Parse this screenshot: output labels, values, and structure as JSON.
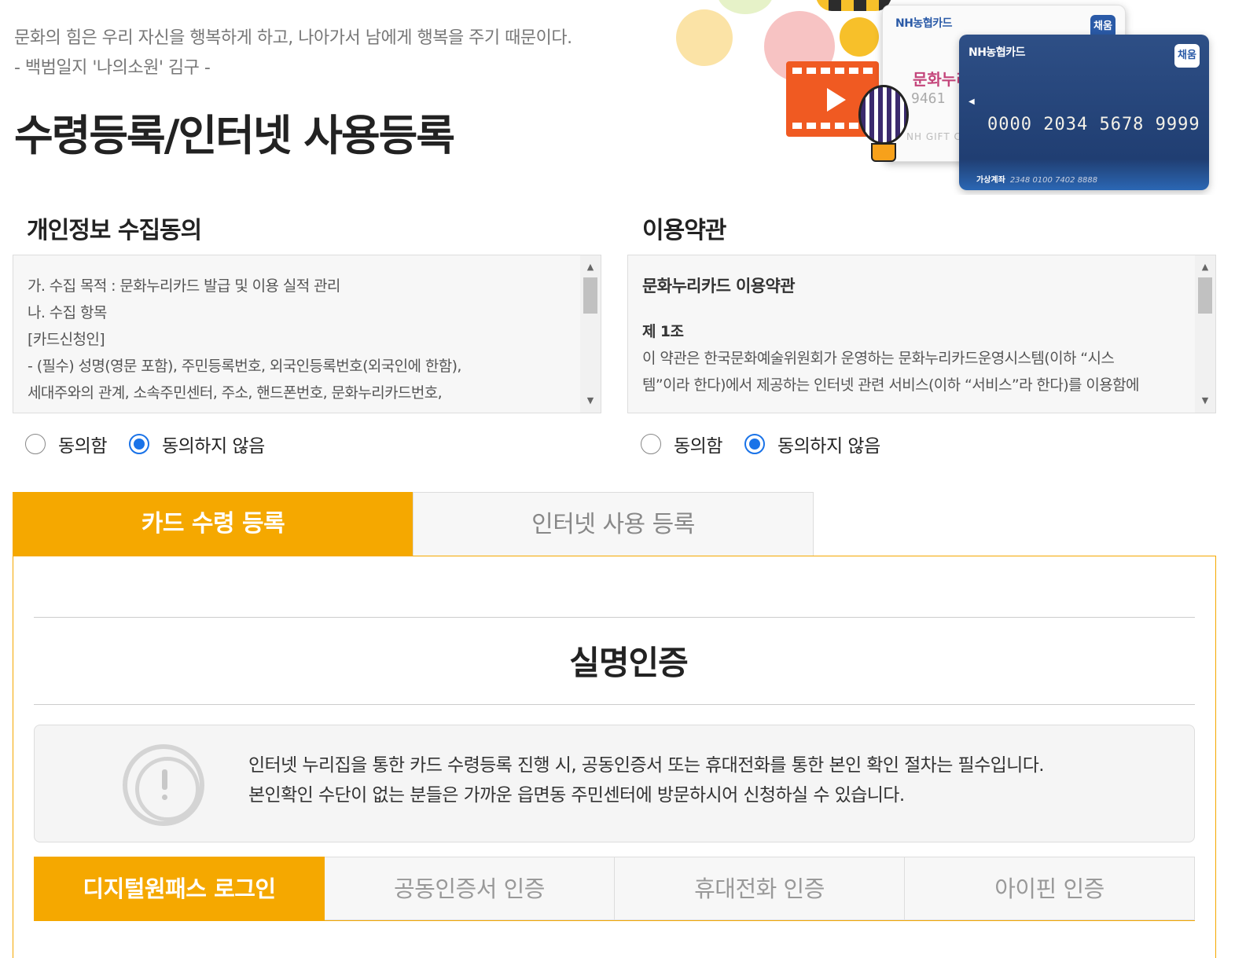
{
  "header": {
    "quote_line1": "문화의 힘은 우리 자신을 행복하게 하고, 나아가서 남에게 행복을 주기 때문이다.",
    "quote_line2": "- 백범일지 '나의소원' 김구 -",
    "title": "수령등록/인터넷 사용등록"
  },
  "hero": {
    "card_white": {
      "brand": "NH농협카드",
      "chip": "채움",
      "product": "문화누리",
      "number": "9461",
      "footer": "NH GIFT CA"
    },
    "card_blue": {
      "brand": "NH농협카드",
      "chip": "채움",
      "number": "0000 2034 5678 9999",
      "account_label": "가상계좌",
      "account_number": "2348 0100 7402 8888"
    },
    "colors": {
      "brand_blue": "#2a5aa7",
      "card_blue": "#203e72",
      "film_orange": "#f05a22"
    }
  },
  "privacy": {
    "title": "개인정보 수집동의",
    "lines": [
      "가. 수집 목적 : 문화누리카드 발급 및 이용 실적 관리",
      "나. 수집 항목",
      "[카드신청인]",
      "- (필수) 성명(영문 포함), 주민등록번호, 외국인등록번호(외국인에 한함),",
      "세대주와의 관계, 소속주민센터, 주소, 핸드폰번호, 문화누리카드번호,"
    ],
    "agree_label": "동의함",
    "disagree_label": "동의하지 않음",
    "selected": "disagree"
  },
  "terms": {
    "title": "이용약관",
    "heading": "문화누리카드 이용약관",
    "article": "제 1조",
    "lines": [
      "이 약관은 한국문화예술위원회가 운영하는 문화누리카드운영시스템(이하 “시스",
      "템”이라 한다)에서 제공하는 인터넷 관련 서비스(이하 “서비스”라 한다)를 이용함에"
    ],
    "agree_label": "동의함",
    "disagree_label": "동의하지 않음",
    "selected": "disagree"
  },
  "tabs": {
    "card_receipt": "카드 수령 등록",
    "internet_use": "인터넷 사용 등록",
    "active": "card_receipt"
  },
  "verification": {
    "title": "실명인증",
    "notice_line1": "인터넷 누리집을 통한 카드 수령등록 진행 시, 공동인증서 또는 휴대전화를 통한 본인 확인 절차는 필수입니다.",
    "notice_line2": "본인확인 수단이 없는 분들은 가까운 읍면동 주민센터에 방문하시어 신청하실 수 있습니다.",
    "methods": [
      "디지털원패스 로그인",
      "공동인증서 인증",
      "휴대전화 인증",
      "아이핀 인증"
    ],
    "active_method": "디지털원패스 로그인"
  },
  "theme": {
    "accent": "#f5a800",
    "radio_blue": "#1a73e8"
  }
}
